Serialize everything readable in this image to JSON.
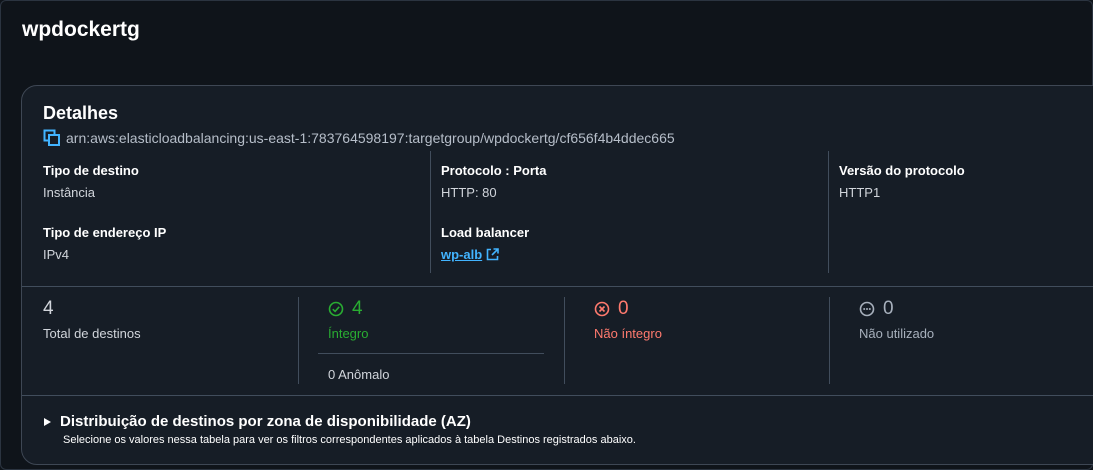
{
  "page": {
    "title": "wpdockertg"
  },
  "details": {
    "title": "Detalhes",
    "arn": "arn:aws:elasticloadbalancing:us-east-1:783764598197:targetgroup/wpdockertg/cf656f4b4ddec665",
    "target_type": {
      "label": "Tipo de destino",
      "value": "Instância"
    },
    "protocol_port": {
      "label": "Protocolo : Porta",
      "value": "HTTP: 80"
    },
    "protocol_version": {
      "label": "Versão do protocolo",
      "value": "HTTP1"
    },
    "ip_address_type": {
      "label": "Tipo de endereço IP",
      "value": "IPv4"
    },
    "load_balancer": {
      "label": "Load balancer",
      "value": "wp-alb"
    }
  },
  "stats": {
    "total": {
      "count": "4",
      "label": "Total de destinos"
    },
    "healthy": {
      "count": "4",
      "label": "Íntegro",
      "anomalous": "0 Anômalo"
    },
    "unhealthy": {
      "count": "0",
      "label": "Não íntegro"
    },
    "unused": {
      "count": "0",
      "label": "Não utilizado"
    }
  },
  "az_section": {
    "title": "Distribuição de destinos por zona de disponibilidade (AZ)",
    "description": "Selecione os valores nessa tabela para ver os filtros correspondentes aplicados à tabela Destinos registrados abaixo."
  },
  "colors": {
    "healthy": "#29ad32",
    "unhealthy": "#ff7a6e",
    "link": "#42b4ff",
    "background": "#0f141a",
    "card": "#161d26"
  },
  "icons": [
    "copy-icon",
    "external-link-icon",
    "check-circle-icon",
    "x-circle-icon",
    "ellipsis-circle-icon",
    "caret-right-icon"
  ]
}
